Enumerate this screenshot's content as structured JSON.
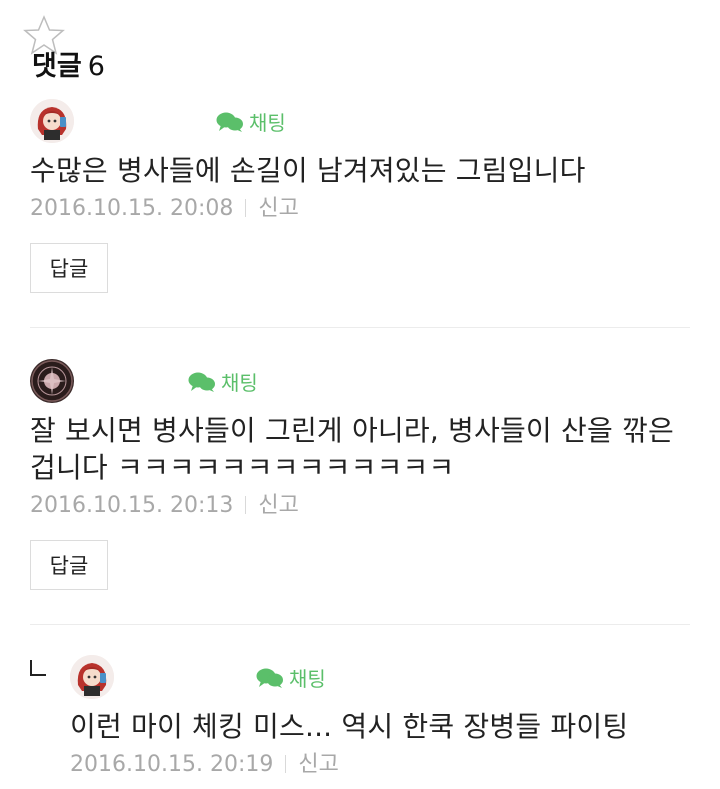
{
  "header": {
    "title": "댓글",
    "count": "6"
  },
  "comments": [
    {
      "nickname": "",
      "chat_label": "채팅",
      "text": "수많은 병사들에 손길이 남겨져있는 그림입니다",
      "date": "2016.10.15. 20:08",
      "report_label": "신고",
      "reply_label": "답글"
    },
    {
      "nickname": "",
      "chat_label": "채팅",
      "text": "잘 보시면 병사들이 그린게 아니라, 병사들이 산을 깎은겁니다 ㅋㅋㅋㅋㅋㅋㅋㅋㅋㅋㅋㅋㅋ",
      "date": "2016.10.15. 20:13",
      "report_label": "신고",
      "reply_label": "답글"
    }
  ],
  "reply": {
    "nickname": "",
    "chat_label": "채팅",
    "text": "이런 마이 체킹 미스... 역시 한쿡 장병들 파이팅",
    "date": "2016.10.15. 20:19",
    "report_label": "신고"
  },
  "colors": {
    "chat_green": "#5bbf6a",
    "meta_gray": "#a8a8a8",
    "divider": "#ececec"
  },
  "icons": {
    "favorite": "star-outline-icon",
    "chat": "speech-bubble-icon",
    "reply_indicator": "reply-arrow-icon"
  }
}
